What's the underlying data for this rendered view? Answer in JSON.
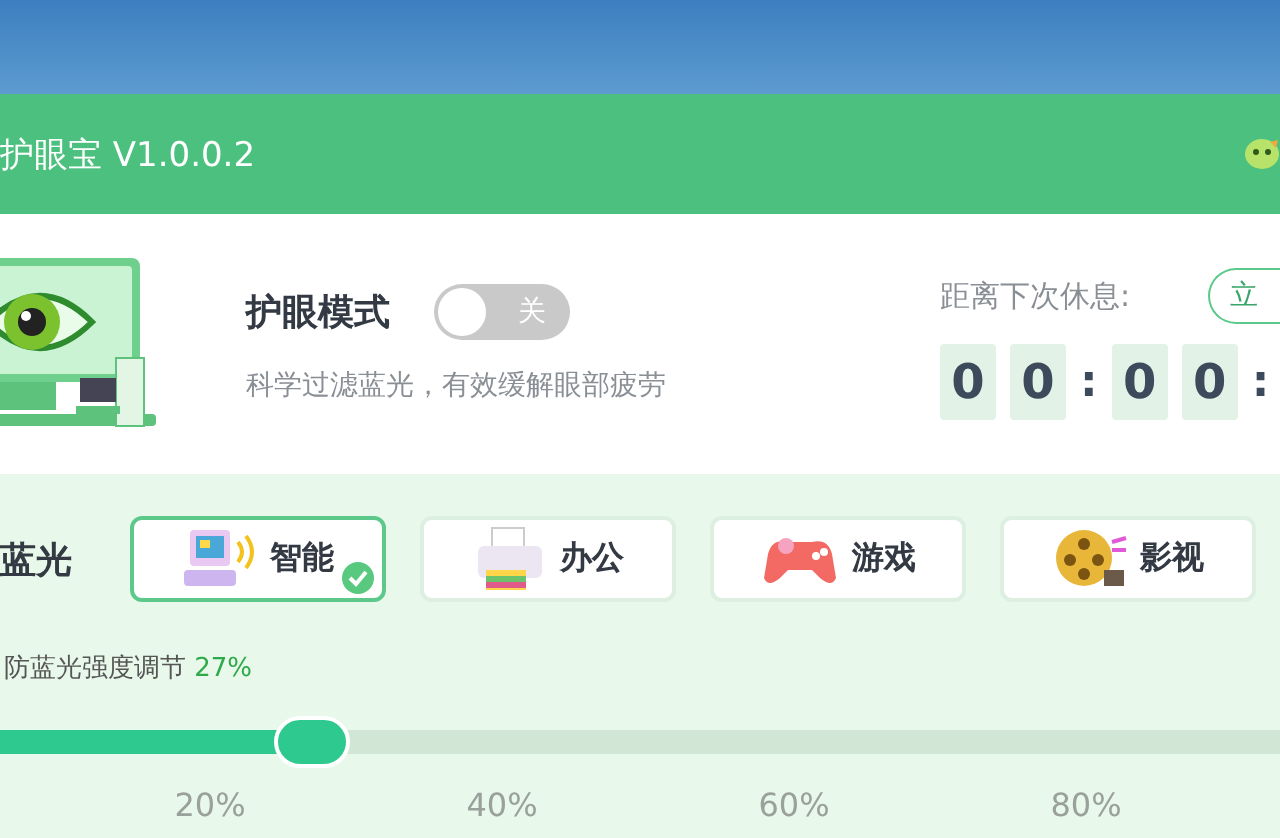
{
  "window": {
    "title": "护眼宝 V1.0.0.2"
  },
  "eye_care": {
    "title": "护眼模式",
    "toggle": {
      "on": false,
      "label": "关"
    },
    "subtitle": "科学过滤蓝光，有效缓解眼部疲劳"
  },
  "rest_timer": {
    "label": "距离下次休息:",
    "button": "立",
    "parts": [
      {
        "kind": "digit",
        "text": "0"
      },
      {
        "kind": "digit",
        "text": "0"
      },
      {
        "kind": "colon",
        "text": ":"
      },
      {
        "kind": "digit",
        "text": "0"
      },
      {
        "kind": "digit",
        "text": "0"
      },
      {
        "kind": "colon",
        "text": ":"
      }
    ]
  },
  "filter": {
    "label": "蓝光",
    "modes": [
      {
        "label": "智能",
        "kind": "smart",
        "selected": true
      },
      {
        "label": "办公",
        "kind": "office",
        "selected": false
      },
      {
        "label": "游戏",
        "kind": "game",
        "selected": false
      },
      {
        "label": "影视",
        "kind": "movie",
        "selected": false
      }
    ]
  },
  "strength": {
    "label": "防蓝光强度调节",
    "value": "27%",
    "level": 0.27,
    "ticks": [
      "20%",
      "40%",
      "60%",
      "80%"
    ]
  }
}
